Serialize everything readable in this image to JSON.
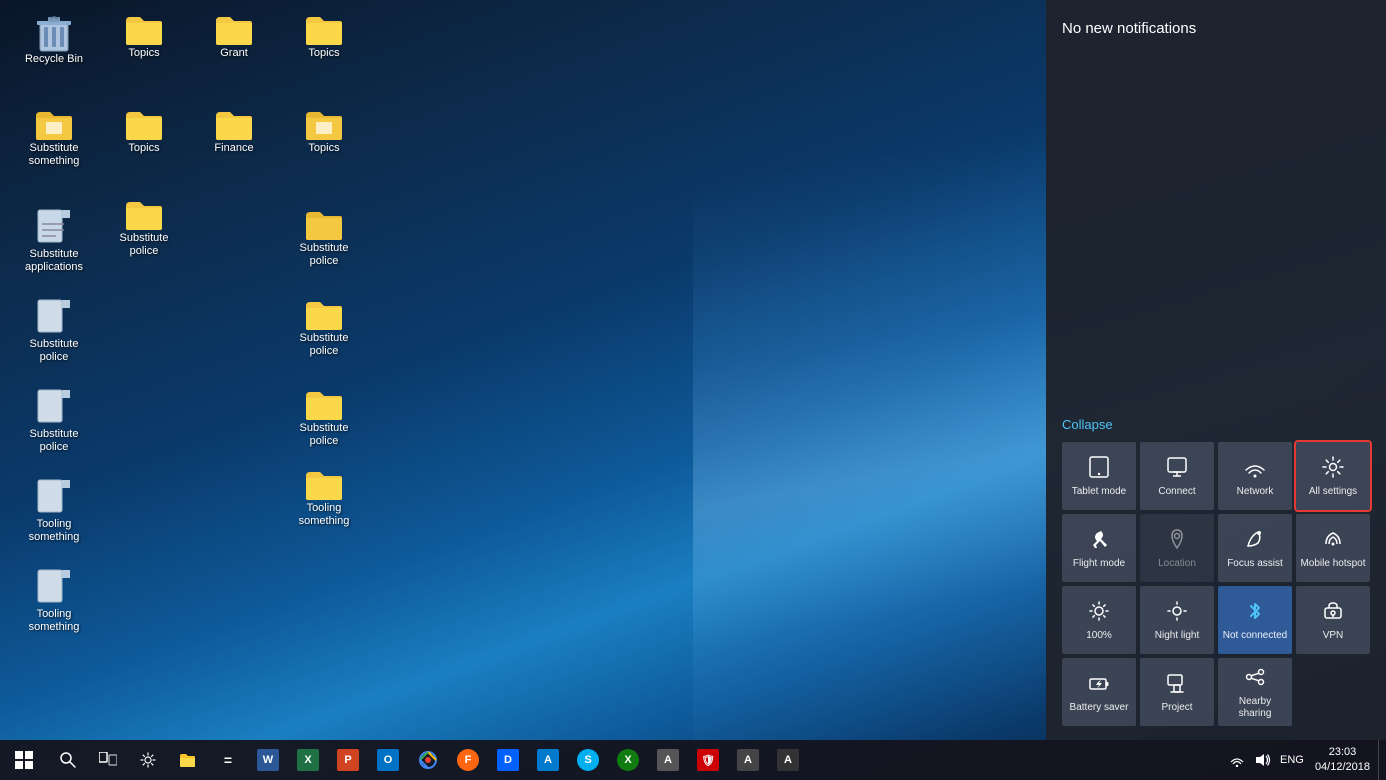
{
  "desktop": {
    "background": "windows10-blue",
    "icons": [
      {
        "id": "recycle-bin",
        "label": "Recycle Bin",
        "type": "recycle-bin"
      },
      {
        "id": "folder1",
        "label": "Topics",
        "type": "folder"
      },
      {
        "id": "folder2",
        "label": "Grant",
        "type": "folder"
      },
      {
        "id": "folder3",
        "label": "Topics",
        "type": "folder"
      },
      {
        "id": "folder4",
        "label": "Substitute something",
        "type": "folder-doc"
      },
      {
        "id": "folder5",
        "label": "Topics",
        "type": "folder"
      },
      {
        "id": "folder6",
        "label": "Finance",
        "type": "folder"
      },
      {
        "id": "folder7",
        "label": "Topics",
        "type": "folder"
      },
      {
        "id": "folder8",
        "label": "Substitute applications",
        "type": "folder-doc"
      },
      {
        "id": "folder9",
        "label": "Substitute police",
        "type": "folder-img"
      },
      {
        "id": "folder10",
        "label": "Substitute police",
        "type": "folder-img"
      },
      {
        "id": "folder11",
        "label": "Substitute police",
        "type": "folder-img"
      },
      {
        "id": "folder12",
        "label": "Substitute police",
        "type": "folder-img"
      },
      {
        "id": "folder13",
        "label": "Substitute police",
        "type": "folder-img"
      },
      {
        "id": "folder14",
        "label": "Substitute police",
        "type": "folder-img"
      },
      {
        "id": "folder15",
        "label": "Tooling something",
        "type": "folder"
      },
      {
        "id": "folder16",
        "label": "Tooling something",
        "type": "folder"
      },
      {
        "id": "folder17",
        "label": "Tooling something",
        "type": "folder"
      }
    ]
  },
  "action_center": {
    "no_notifications_text": "No new notifications",
    "collapse_label": "Collapse",
    "quick_actions": [
      {
        "id": "tablet-mode",
        "label": "Tablet mode",
        "icon": "⬜",
        "active": false
      },
      {
        "id": "connect",
        "label": "Connect",
        "icon": "🖥",
        "active": false
      },
      {
        "id": "network",
        "label": "Network",
        "icon": "📶",
        "active": false
      },
      {
        "id": "all-settings",
        "label": "All settings",
        "icon": "⚙",
        "active": false,
        "highlighted": true
      },
      {
        "id": "flight-mode",
        "label": "Flight mode",
        "icon": "✈",
        "active": false
      },
      {
        "id": "location",
        "label": "Location",
        "icon": "📍",
        "active": false,
        "dim": true
      },
      {
        "id": "focus-assist",
        "label": "Focus assist",
        "icon": "🌙",
        "active": false
      },
      {
        "id": "mobile-hotspot",
        "label": "Mobile hotspot",
        "icon": "📡",
        "active": false
      },
      {
        "id": "brightness",
        "label": "100%",
        "icon": "☀",
        "active": false
      },
      {
        "id": "night-light",
        "label": "Night light",
        "icon": "💡",
        "active": false
      },
      {
        "id": "bluetooth",
        "label": "Not connected",
        "icon": "🔵",
        "active": true,
        "bluetooth": true
      },
      {
        "id": "vpn",
        "label": "VPN",
        "icon": "🔗",
        "active": false
      },
      {
        "id": "battery-saver",
        "label": "Battery saver",
        "icon": "🔋",
        "active": false
      },
      {
        "id": "project",
        "label": "Project",
        "icon": "📺",
        "active": false
      },
      {
        "id": "nearby-sharing",
        "label": "Nearby sharing",
        "icon": "📤",
        "active": false
      }
    ]
  },
  "taskbar": {
    "start_icon": "⊞",
    "clock": {
      "time": "23:03",
      "date": "04/12/2018"
    },
    "apps": [
      {
        "id": "search",
        "label": "Search",
        "icon": "🔍"
      },
      {
        "id": "task-view",
        "label": "Task View",
        "icon": "❑"
      },
      {
        "id": "settings",
        "label": "Settings",
        "icon": "⚙"
      },
      {
        "id": "explorer",
        "label": "File Explorer",
        "icon": "📁"
      },
      {
        "id": "calculator",
        "label": "Calculator",
        "icon": "🔢"
      },
      {
        "id": "word",
        "label": "Word",
        "icon": "W"
      },
      {
        "id": "excel",
        "label": "Excel",
        "icon": "X"
      },
      {
        "id": "powerpoint",
        "label": "PowerPoint",
        "icon": "P"
      },
      {
        "id": "outlook",
        "label": "Outlook",
        "icon": "O"
      },
      {
        "id": "chrome",
        "label": "Chrome",
        "icon": "C"
      },
      {
        "id": "firefox",
        "label": "Firefox",
        "icon": "F"
      },
      {
        "id": "dropbox",
        "label": "Dropbox",
        "icon": "D"
      },
      {
        "id": "app1",
        "label": "App",
        "icon": "A"
      },
      {
        "id": "skype",
        "label": "Skype",
        "icon": "S"
      },
      {
        "id": "xbox",
        "label": "Xbox",
        "icon": "X"
      },
      {
        "id": "app2",
        "label": "App",
        "icon": "A"
      },
      {
        "id": "antivirus",
        "label": "Antivirus",
        "icon": "🛡"
      },
      {
        "id": "app3",
        "label": "App",
        "icon": "A"
      },
      {
        "id": "app4",
        "label": "App",
        "icon": "A"
      }
    ],
    "systray": {
      "eng_label": "ENG",
      "volume_icon": "🔊",
      "network_icon": "📶",
      "show_desktop": "□"
    }
  }
}
